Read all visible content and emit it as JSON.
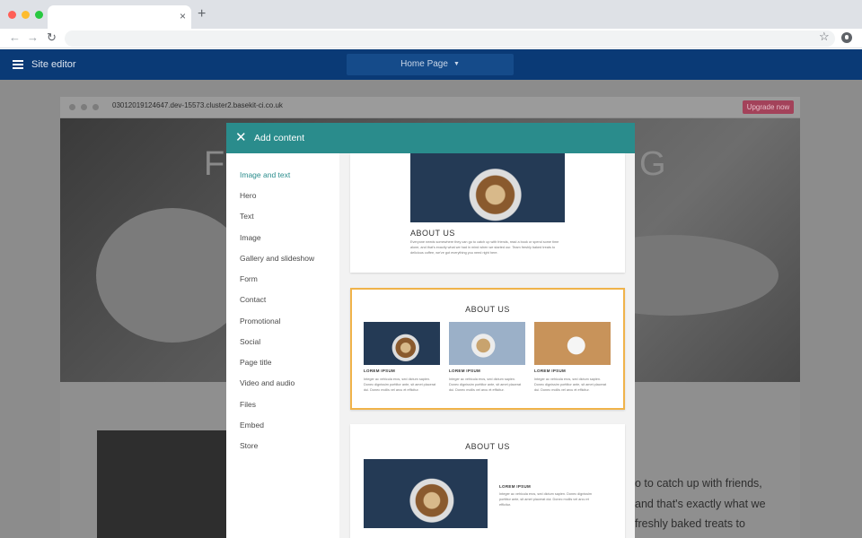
{
  "browser": {
    "colors": {
      "close": "#ff5f57",
      "minimize": "#febc2e",
      "maximize": "#28c840"
    },
    "tab_close": "×",
    "new_tab": "+",
    "back": "←",
    "forward": "→",
    "reload": "↻",
    "bookmark": "☆"
  },
  "editor": {
    "title": "Site editor",
    "page_select": "Home Page",
    "page_caret": "▼"
  },
  "site": {
    "url": "03012019124647.dev-15573.cluster2.basekit-ci.co.uk",
    "upgrade_label": "Upgrade now",
    "hero_left": "F",
    "hero_right": "G",
    "body_lines": [
      "o to catch up with friends,",
      "and that's exactly what we",
      "freshly baked treats to"
    ]
  },
  "modal": {
    "title": "Add content",
    "close": "✕",
    "categories": [
      "Image and text",
      "Hero",
      "Text",
      "Image",
      "Gallery and slideshow",
      "Form",
      "Contact",
      "Promotional",
      "Social",
      "Page title",
      "Video and audio",
      "Files",
      "Embed",
      "Store"
    ],
    "active_category": "Image and text",
    "accent_color": "#2a8c8c",
    "selected_border_color": "#f0b34a",
    "previews": {
      "one": {
        "title": "ABOUT US",
        "text": "Everyone needs somewhere they can go to catch up with friends, read a book or spend some time alone, and that's exactly what we had in mind when we started our. Team freshly baked treats to delicious coffee, we've got everything you need right here."
      },
      "two": {
        "title": "ABOUT US",
        "columns": [
          {
            "label": "LOREM IPSUM",
            "text": "Integer ac vehicula eros, sed dictum sapien. Donec dignissim porttitor ante, sit amet placerat dui. Donec mollis vel arcu et efficitur."
          },
          {
            "label": "LOREM IPSUM",
            "text": "Integer ac vehicula eros, sed dictum sapien. Donec dignissim porttitor ante, sit amet placerat dui. Donec mollis vel arcu et efficitur."
          },
          {
            "label": "LOREM IPSUM",
            "text": "Integer ac vehicula eros, sed dictum sapien. Donec dignissim porttitor ante, sit amet placerat dui. Donec mollis vel arcu et efficitur."
          }
        ]
      },
      "three": {
        "title": "ABOUT US",
        "label": "LOREM IPSUM",
        "text": "Integer ac vehicula eros, sed dictum sapien. Donec dignissim porttitor ante, sit amet placerat dui. Donec mollis vel arcu et efficitur."
      }
    }
  }
}
